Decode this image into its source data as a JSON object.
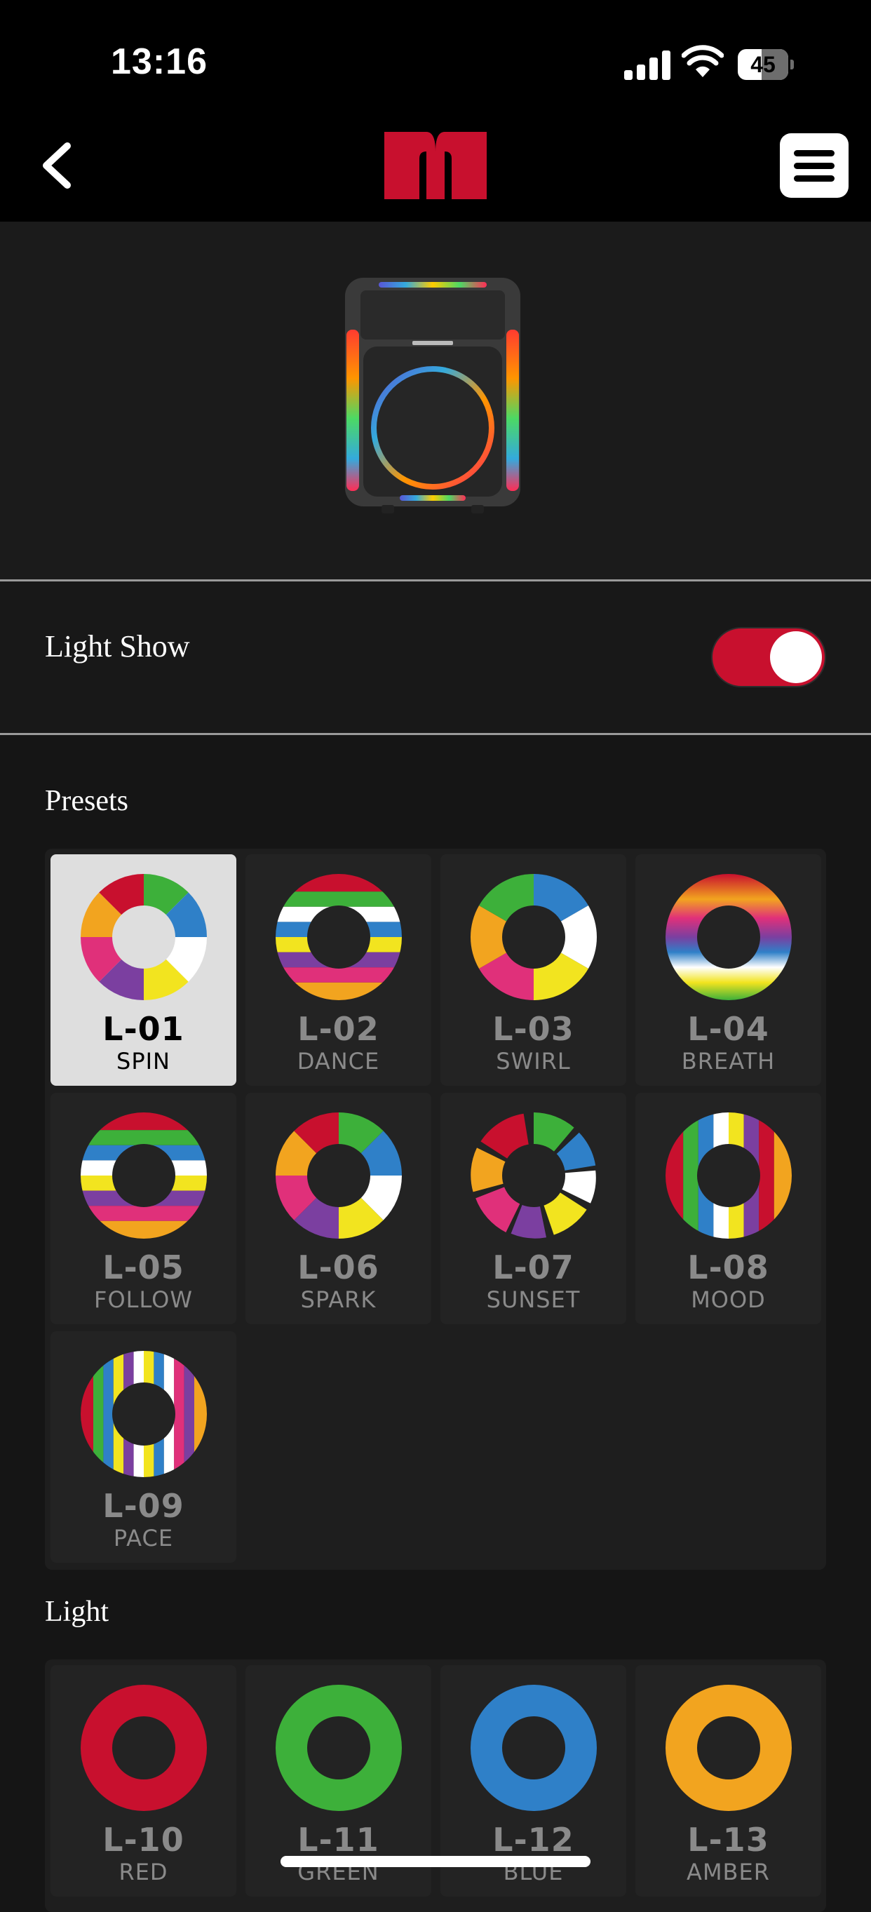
{
  "status": {
    "time": "13:16",
    "battery": "45"
  },
  "light_show": {
    "label": "Light Show",
    "enabled": true
  },
  "presets": {
    "title": "Presets",
    "items": [
      {
        "code": "L-01",
        "name": "SPIN",
        "selected": true
      },
      {
        "code": "L-02",
        "name": "DANCE",
        "selected": false
      },
      {
        "code": "L-03",
        "name": "SWIRL",
        "selected": false
      },
      {
        "code": "L-04",
        "name": "BREATH",
        "selected": false
      },
      {
        "code": "L-05",
        "name": "FOLLOW",
        "selected": false
      },
      {
        "code": "L-06",
        "name": "SPARK",
        "selected": false
      },
      {
        "code": "L-07",
        "name": "SUNSET",
        "selected": false
      },
      {
        "code": "L-08",
        "name": "MOOD",
        "selected": false
      },
      {
        "code": "L-09",
        "name": "PACE",
        "selected": false
      }
    ]
  },
  "light": {
    "title": "Light",
    "items": [
      {
        "code": "L-10",
        "name": "RED",
        "color": "#c8102e"
      },
      {
        "code": "L-11",
        "name": "GREEN",
        "color": "#3db03a"
      },
      {
        "code": "L-12",
        "name": "BLUE",
        "color": "#2f80c8"
      },
      {
        "code": "L-13",
        "name": "AMBER",
        "color": "#f2a41f"
      }
    ]
  },
  "colors": {
    "accent": "#c8102e",
    "background": "#151515"
  }
}
